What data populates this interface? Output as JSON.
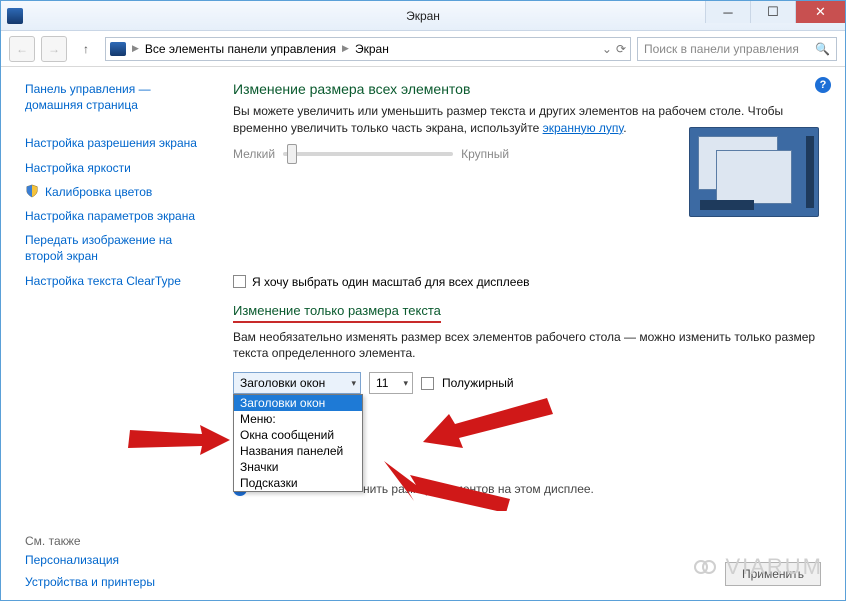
{
  "titlebar": {
    "title": "Экран"
  },
  "toolbar": {
    "breadcrumb_root": "Все элементы панели управления",
    "breadcrumb_leaf": "Экран",
    "search_placeholder": "Поиск в панели управления"
  },
  "sidebar": {
    "home1": "Панель управления —",
    "home2": "домашняя страница",
    "links": [
      "Настройка разрешения экрана",
      "Настройка яркости",
      "Калибровка цветов",
      "Настройка параметров экрана",
      "Передать изображение на второй экран",
      "Настройка текста ClearType"
    ],
    "see_also": "См. также",
    "personalization": "Персонализация",
    "devices": "Устройства и принтеры"
  },
  "main": {
    "heading1": "Изменение размера всех элементов",
    "para1a": "Вы можете увеличить или уменьшить размер текста и других элементов на рабочем столе. Чтобы временно увеличить только часть экрана, используйте ",
    "magnifier_link": "экранную лупу",
    "small_label": "Мелкий",
    "large_label": "Крупный",
    "one_scale_cb": "Я хочу выбрать один масштаб для всех дисплеев",
    "heading2": "Изменение только размера текста",
    "para2": "Вам необязательно изменять размер всех элементов рабочего стола — можно изменить только размер текста определенного элемента.",
    "select_value": "Заголовки окон",
    "size_value": "11",
    "bold_label": "Полужирный",
    "dropdown_options": [
      "Заголовки окон",
      "Меню:",
      "Окна сообщений",
      "Названия панелей",
      "Значки",
      "Подсказки"
    ],
    "note": "нить размер элементов на этом дисплее.",
    "apply": "Применить"
  },
  "watermark": "VIARUM"
}
